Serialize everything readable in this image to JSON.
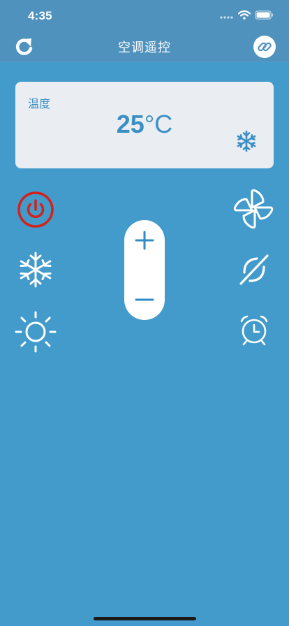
{
  "status_bar": {
    "time": "4:35",
    "icons": [
      "signal-icon",
      "wifi-icon",
      "battery-icon"
    ]
  },
  "nav": {
    "title": "空调遥控",
    "left_icon": "refresh-icon",
    "right_icon": "link-icon"
  },
  "temperature_card": {
    "label": "温度",
    "value": "25",
    "unit": "°C",
    "mode_icon": "snowflake-icon"
  },
  "controls": {
    "left": [
      "power-icon",
      "snowflake-icon",
      "sun-icon"
    ],
    "right": [
      "fan-icon",
      "swing-off-icon",
      "alarm-clock-icon"
    ],
    "stepper": [
      "plus-icon",
      "minus-icon"
    ]
  },
  "colors": {
    "background": "#429bca",
    "header": "#4f92bd",
    "card": "#eaedf2",
    "accent": "#3a8fc4",
    "power": "#d2231b"
  }
}
